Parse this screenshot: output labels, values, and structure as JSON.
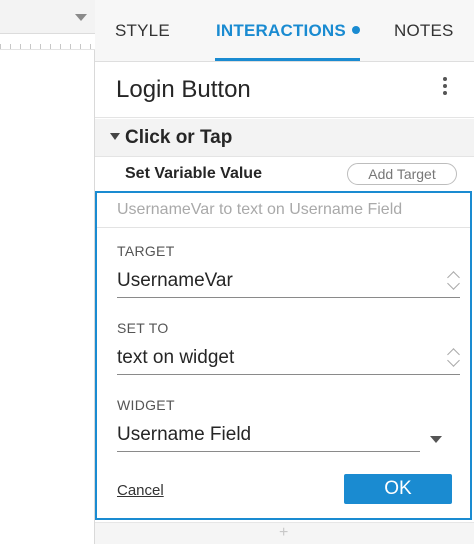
{
  "tabs": [
    {
      "label": "STYLE",
      "active": false
    },
    {
      "label": "INTERACTIONS",
      "active": true
    },
    {
      "label": "NOTES",
      "active": false
    }
  ],
  "widget": {
    "title": "Login Button"
  },
  "event": {
    "label": "Click or Tap"
  },
  "action": {
    "label": "Set Variable Value",
    "add_target_label": "Add Target"
  },
  "editor": {
    "summary": "UsernameVar to text on Username Field",
    "target": {
      "label": "TARGET",
      "value": "UsernameVar"
    },
    "set_to": {
      "label": "SET TO",
      "value": "text on widget"
    },
    "widget": {
      "label": "WIDGET",
      "value": "Username Field"
    },
    "cancel_label": "Cancel",
    "ok_label": "OK"
  },
  "add_row": {
    "symbol": "+"
  },
  "colors": {
    "accent": "#1a8bd1",
    "text": "#262626",
    "muted": "#a9a9a9"
  }
}
